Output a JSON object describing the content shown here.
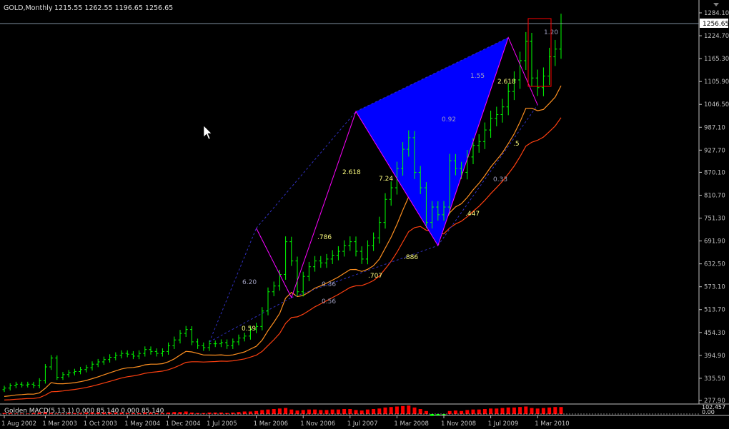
{
  "header": {
    "symbol": "GOLD,Monthly",
    "ohlc": "1215.55 1262.55 1196.65 1256.65"
  },
  "current_price_label": "1256.65",
  "indicator": {
    "label": "Golden MACD(5,13,1) 0.000 85.140 0.000 85.140",
    "ylabels": [
      "102.457",
      "0.00"
    ]
  },
  "colors": {
    "background": "#000000",
    "axis": "#c0c0c0",
    "bull_bar": "#00ff00",
    "ma_slow": "#ff4010",
    "ma_fast": "#ff9020",
    "pattern_line": "#ff00ff",
    "pattern_fill": "#0000ff",
    "fib_dash": "#3030c0",
    "fib_text_yellow": "#ffff80",
    "fib_text_gray": "#a0a0c0",
    "macd_pos": "#ff0000",
    "macd_neg": "#00ff00",
    "box": "#ff0000"
  },
  "chart_data": {
    "type": "candlestick-ohlc",
    "y_tick_labels": [
      "1284.10",
      "1224.70",
      "1165.30",
      "1105.90",
      "1046.50",
      "987.10",
      "927.70",
      "870.10",
      "810.70",
      "751.30",
      "691.90",
      "632.50",
      "573.10",
      "513.70",
      "454.30",
      "394.90",
      "335.50",
      "277.90"
    ],
    "ylim": [
      260,
      1300
    ],
    "x_tick_labels": [
      "1 Aug 2002",
      "1 Mar 2003",
      "1 Oct 2003",
      "1 May 2004",
      "1 Dec 2004",
      "1 Jul 2005",
      "1 Mar 2006",
      "1 Nov 2006",
      "1 Jul 2007",
      "1 Mar 2008",
      "1 Nov 2008",
      "1 Jul 2009",
      "1 Mar 2010"
    ],
    "x_tick_months": [
      0,
      7,
      14,
      21,
      28,
      35,
      43,
      51,
      59,
      67,
      75,
      83,
      91
    ],
    "x_start": "Aug 2002",
    "closes": [
      310,
      316,
      320,
      318,
      320,
      316,
      329,
      365,
      388,
      338,
      345,
      350,
      353,
      358,
      363,
      372,
      378,
      384,
      390,
      395,
      400,
      398,
      393,
      400,
      410,
      405,
      400,
      405,
      420,
      435,
      452,
      462,
      430,
      420,
      415,
      425,
      425,
      428,
      420,
      430,
      440,
      445,
      462,
      470,
      510,
      560,
      575,
      605,
      690,
      640,
      560,
      600,
      625,
      640,
      635,
      645,
      655,
      665,
      680,
      690,
      665,
      645,
      680,
      700,
      740,
      800,
      830,
      880,
      930,
      960,
      870,
      830,
      740,
      780,
      760,
      780,
      900,
      880,
      870,
      910,
      940,
      950,
      980,
      1010,
      1020,
      1040,
      1080,
      1110,
      1160,
      1210,
      1115,
      1090,
      1120,
      1170,
      1190,
      1256.65
    ],
    "fib_labels": [
      {
        "text": "6.20",
        "color": "gray"
      },
      {
        "text": ".786",
        "color": "yellow"
      },
      {
        "text": "0.36",
        "color": "gray"
      },
      {
        "text": "0.56",
        "color": "gray"
      },
      {
        "text": "0.59",
        "color": "yellow"
      },
      {
        "text": "2.618",
        "color": "yellow"
      },
      {
        "text": "7.24",
        "color": "yellow"
      },
      {
        "text": ".886",
        "color": "yellow"
      },
      {
        "text": ".707",
        "color": "yellow"
      },
      {
        "text": "1.55",
        "color": "gray"
      },
      {
        "text": "0.92",
        "color": "gray"
      },
      {
        "text": "2.618",
        "color": "yellow"
      },
      {
        "text": ".447",
        "color": "yellow"
      },
      {
        "text": "0.33",
        "color": "gray"
      },
      {
        "text": ".5",
        "color": "yellow"
      },
      {
        "text": "1.20",
        "color": "gray"
      }
    ],
    "pattern_points": [
      {
        "month": 43,
        "price": 725
      },
      {
        "month": 49,
        "price": 545
      },
      {
        "month": 60,
        "price": 1028
      },
      {
        "month": 74,
        "price": 680
      },
      {
        "month": 86,
        "price": 1220
      },
      {
        "month": 91,
        "price": 1045
      }
    ],
    "macd_values": [
      2,
      2,
      1,
      1,
      1,
      2,
      3,
      4,
      2,
      1,
      1,
      2,
      2,
      2,
      3,
      3,
      3,
      3,
      3,
      3,
      3,
      2,
      2,
      2,
      3,
      3,
      2,
      2,
      3,
      4,
      4,
      5,
      3,
      2,
      2,
      3,
      3,
      3,
      2,
      3,
      4,
      5,
      5,
      6,
      8,
      9,
      10,
      11,
      12,
      9,
      7,
      8,
      9,
      9,
      8,
      8,
      9,
      9,
      10,
      10,
      8,
      7,
      9,
      10,
      11,
      13,
      14,
      15,
      16,
      17,
      13,
      10,
      6,
      -4,
      -3,
      -2,
      6,
      7,
      6,
      8,
      9,
      9,
      10,
      11,
      11,
      12,
      13,
      13,
      14,
      15,
      12,
      11,
      12,
      13,
      14,
      14
    ]
  }
}
